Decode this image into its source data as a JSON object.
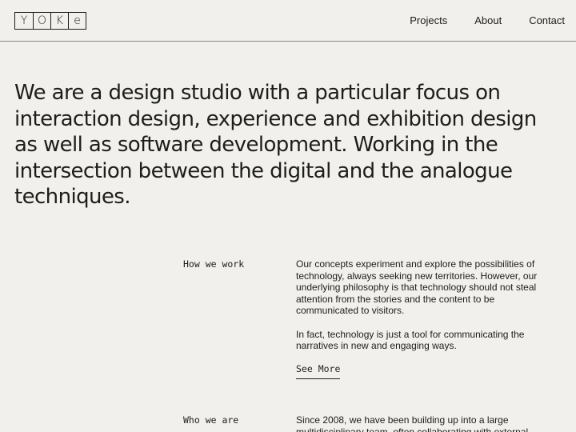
{
  "header": {
    "logo_letters": [
      "Y",
      "O",
      "K",
      "e"
    ],
    "nav": [
      "Projects",
      "About",
      "Contact"
    ]
  },
  "hero": {
    "text": "We are a design studio with a particular focus on interaction design, experience and exhibition design as well as software development. Working in the intersection between the digital and the analogue techniques."
  },
  "sections": [
    {
      "label": "How we work",
      "paragraphs": [
        "Our concepts experiment and explore the possibilities of technology, always seeking new territories. However, our underlying philosophy is that technology should not steal attention from the stories and the content to be communicated to visitors.",
        "In fact, technology is just a tool for communicating the narratives in new and engaging ways."
      ],
      "link": "See More"
    },
    {
      "label": "Who we are",
      "paragraphs": [
        "Since 2008, we have been building up into a large multidisciplinary team, often collaborating with external"
      ]
    }
  ],
  "colors": {
    "background": "#f1f0ec",
    "text": "#1d1d1b",
    "divider": "#8a8a86"
  }
}
